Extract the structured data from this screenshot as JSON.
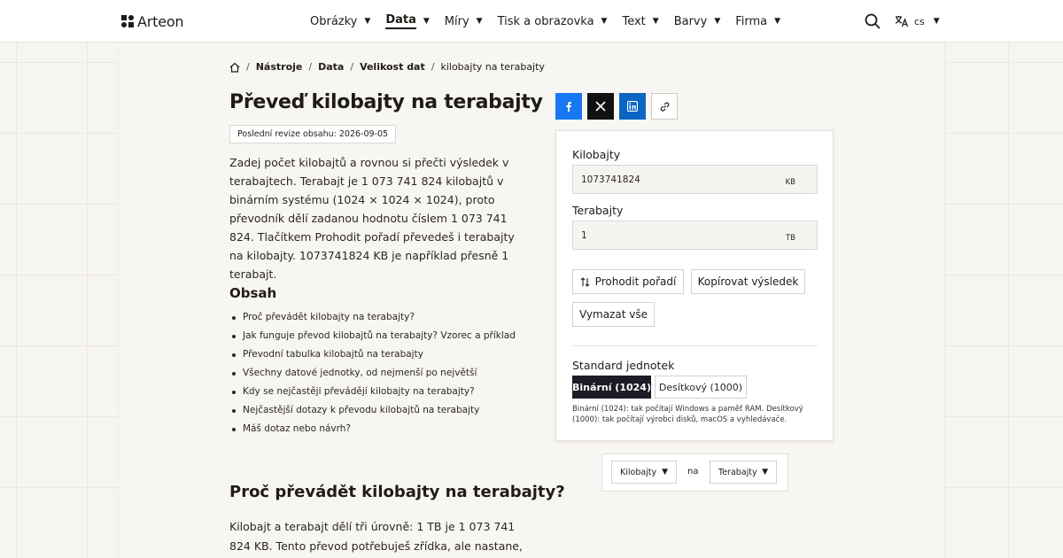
{
  "header": {
    "brand": "Arteon",
    "nav": [
      {
        "label": "Obrázky"
      },
      {
        "label": "Data",
        "active": true
      },
      {
        "label": "Míry"
      },
      {
        "label": "Tisk a obrazovka"
      },
      {
        "label": "Text"
      },
      {
        "label": "Barvy"
      },
      {
        "label": "Firma"
      }
    ],
    "language": "cs"
  },
  "breadcrumb": {
    "items": [
      "Nástroje",
      "Data",
      "Velikost dat"
    ],
    "current": "kilobajty na terabajty"
  },
  "page": {
    "title": "Převeď kilobajty na terabajty",
    "revision": "Poslední revize obsahu: 2026-09-05",
    "intro": "Zadej počet kilobajtů a rovnou si přečti výsledek v terabajtech. Terabajt je 1 073 741 824 kilobajtů v binárním systému (1024 × 1024 × 1024), proto převodník dělí zadanou hodnotu číslem 1 073 741 824. Tlačítkem Prohodit pořadí převedeš i terabajty na kilobajty. 1073741824 KB je například přesně 1 terabajt.",
    "toc_title": "Obsah",
    "toc": [
      "Proč převádět kilobajty na terabajty?",
      "Jak funguje převod kilobajtů na terabajty? Vzorec a příklad",
      "Převodní tabulka kilobajtů na terabajty",
      "Všechny datové jednotky, od nejmenší po největší",
      "Kdy se nejčastěji převádějí kilobajty na terabajty?",
      "Nejčastější dotazy k převodu kilobajtů na terabajty",
      "Máš dotaz nebo návrh?"
    ],
    "section_title": "Proč převádět kilobajty na terabajty?",
    "section_body": "Kilobajt a terabajt dělí tři úrovně: 1 TB je 1 073 741 824 KB. Tento převod potřebuješ zřídka, ale nastane, když sčítáš"
  },
  "converter": {
    "from_label": "Kilobajty",
    "from_value": "1073741824",
    "from_unit": "KB",
    "to_label": "Terabajty",
    "to_value": "1",
    "to_unit": "TB",
    "swap_label": "Prohodit pořadí",
    "copy_label": "Kopírovat výsledek",
    "clear_label": "Vymazat vše",
    "standard_label": "Standard jednotek",
    "binary_label": "Binární (1024)",
    "decimal_label": "Desítkový (1000)",
    "standard_note": "Binární (1024): tak počítají Windows a paměť RAM. Desítkový (1000): tak počítají výrobci disků, macOS a vyhledávače."
  },
  "unit_picker": {
    "from": "Kilobajty",
    "connector": "na",
    "to": "Terabajty"
  },
  "colors": {
    "facebook": "#1877f2",
    "x": "#111111",
    "linkedin": "#0a66c2",
    "active_segment": "#1c1b26"
  }
}
